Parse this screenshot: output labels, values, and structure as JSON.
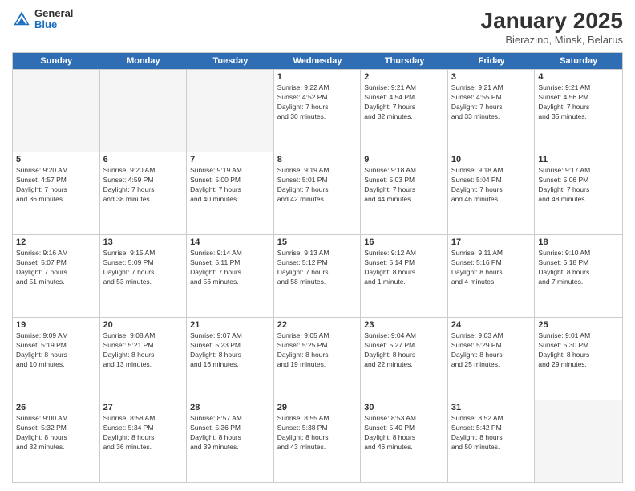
{
  "header": {
    "logo_general": "General",
    "logo_blue": "Blue",
    "month": "January 2025",
    "location": "Bierazino, Minsk, Belarus"
  },
  "weekdays": [
    "Sunday",
    "Monday",
    "Tuesday",
    "Wednesday",
    "Thursday",
    "Friday",
    "Saturday"
  ],
  "weeks": [
    [
      {
        "day": "",
        "info": ""
      },
      {
        "day": "",
        "info": ""
      },
      {
        "day": "",
        "info": ""
      },
      {
        "day": "1",
        "info": "Sunrise: 9:22 AM\nSunset: 4:52 PM\nDaylight: 7 hours\nand 30 minutes."
      },
      {
        "day": "2",
        "info": "Sunrise: 9:21 AM\nSunset: 4:54 PM\nDaylight: 7 hours\nand 32 minutes."
      },
      {
        "day": "3",
        "info": "Sunrise: 9:21 AM\nSunset: 4:55 PM\nDaylight: 7 hours\nand 33 minutes."
      },
      {
        "day": "4",
        "info": "Sunrise: 9:21 AM\nSunset: 4:56 PM\nDaylight: 7 hours\nand 35 minutes."
      }
    ],
    [
      {
        "day": "5",
        "info": "Sunrise: 9:20 AM\nSunset: 4:57 PM\nDaylight: 7 hours\nand 36 minutes."
      },
      {
        "day": "6",
        "info": "Sunrise: 9:20 AM\nSunset: 4:59 PM\nDaylight: 7 hours\nand 38 minutes."
      },
      {
        "day": "7",
        "info": "Sunrise: 9:19 AM\nSunset: 5:00 PM\nDaylight: 7 hours\nand 40 minutes."
      },
      {
        "day": "8",
        "info": "Sunrise: 9:19 AM\nSunset: 5:01 PM\nDaylight: 7 hours\nand 42 minutes."
      },
      {
        "day": "9",
        "info": "Sunrise: 9:18 AM\nSunset: 5:03 PM\nDaylight: 7 hours\nand 44 minutes."
      },
      {
        "day": "10",
        "info": "Sunrise: 9:18 AM\nSunset: 5:04 PM\nDaylight: 7 hours\nand 46 minutes."
      },
      {
        "day": "11",
        "info": "Sunrise: 9:17 AM\nSunset: 5:06 PM\nDaylight: 7 hours\nand 48 minutes."
      }
    ],
    [
      {
        "day": "12",
        "info": "Sunrise: 9:16 AM\nSunset: 5:07 PM\nDaylight: 7 hours\nand 51 minutes."
      },
      {
        "day": "13",
        "info": "Sunrise: 9:15 AM\nSunset: 5:09 PM\nDaylight: 7 hours\nand 53 minutes."
      },
      {
        "day": "14",
        "info": "Sunrise: 9:14 AM\nSunset: 5:11 PM\nDaylight: 7 hours\nand 56 minutes."
      },
      {
        "day": "15",
        "info": "Sunrise: 9:13 AM\nSunset: 5:12 PM\nDaylight: 7 hours\nand 58 minutes."
      },
      {
        "day": "16",
        "info": "Sunrise: 9:12 AM\nSunset: 5:14 PM\nDaylight: 8 hours\nand 1 minute."
      },
      {
        "day": "17",
        "info": "Sunrise: 9:11 AM\nSunset: 5:16 PM\nDaylight: 8 hours\nand 4 minutes."
      },
      {
        "day": "18",
        "info": "Sunrise: 9:10 AM\nSunset: 5:18 PM\nDaylight: 8 hours\nand 7 minutes."
      }
    ],
    [
      {
        "day": "19",
        "info": "Sunrise: 9:09 AM\nSunset: 5:19 PM\nDaylight: 8 hours\nand 10 minutes."
      },
      {
        "day": "20",
        "info": "Sunrise: 9:08 AM\nSunset: 5:21 PM\nDaylight: 8 hours\nand 13 minutes."
      },
      {
        "day": "21",
        "info": "Sunrise: 9:07 AM\nSunset: 5:23 PM\nDaylight: 8 hours\nand 16 minutes."
      },
      {
        "day": "22",
        "info": "Sunrise: 9:05 AM\nSunset: 5:25 PM\nDaylight: 8 hours\nand 19 minutes."
      },
      {
        "day": "23",
        "info": "Sunrise: 9:04 AM\nSunset: 5:27 PM\nDaylight: 8 hours\nand 22 minutes."
      },
      {
        "day": "24",
        "info": "Sunrise: 9:03 AM\nSunset: 5:29 PM\nDaylight: 8 hours\nand 25 minutes."
      },
      {
        "day": "25",
        "info": "Sunrise: 9:01 AM\nSunset: 5:30 PM\nDaylight: 8 hours\nand 29 minutes."
      }
    ],
    [
      {
        "day": "26",
        "info": "Sunrise: 9:00 AM\nSunset: 5:32 PM\nDaylight: 8 hours\nand 32 minutes."
      },
      {
        "day": "27",
        "info": "Sunrise: 8:58 AM\nSunset: 5:34 PM\nDaylight: 8 hours\nand 36 minutes."
      },
      {
        "day": "28",
        "info": "Sunrise: 8:57 AM\nSunset: 5:36 PM\nDaylight: 8 hours\nand 39 minutes."
      },
      {
        "day": "29",
        "info": "Sunrise: 8:55 AM\nSunset: 5:38 PM\nDaylight: 8 hours\nand 43 minutes."
      },
      {
        "day": "30",
        "info": "Sunrise: 8:53 AM\nSunset: 5:40 PM\nDaylight: 8 hours\nand 46 minutes."
      },
      {
        "day": "31",
        "info": "Sunrise: 8:52 AM\nSunset: 5:42 PM\nDaylight: 8 hours\nand 50 minutes."
      },
      {
        "day": "",
        "info": ""
      }
    ]
  ]
}
